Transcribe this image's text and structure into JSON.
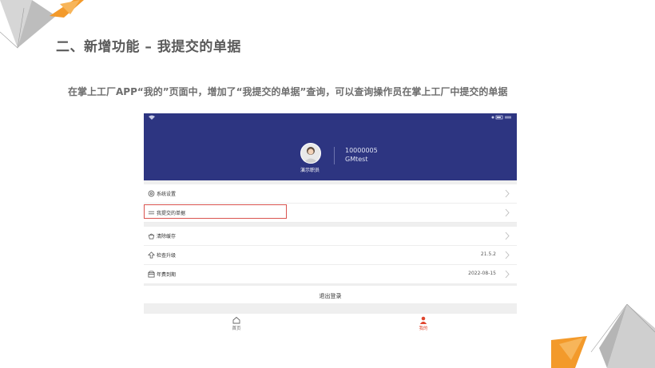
{
  "slide": {
    "title": "二、新增功能 – 我提交的单据",
    "description": "在掌上工厂APP“我的”页面中，增加了“我提交的单据”查询，可以查询操作员在掌上工厂中提交的单据"
  },
  "app": {
    "header": {
      "user_name": "演示职员",
      "user_id": "10000005",
      "account": "GMtest"
    },
    "menu": [
      {
        "icon": "settings-icon",
        "label": "系统设置",
        "value": ""
      },
      {
        "icon": "list-icon",
        "label": "我提交的单据",
        "value": ""
      },
      {
        "icon": "clear-cache-icon",
        "label": "清除缓存",
        "value": ""
      },
      {
        "icon": "upgrade-icon",
        "label": "检查升级",
        "value": "21.5.2"
      },
      {
        "icon": "annual-fee-icon",
        "label": "年费到期",
        "value": "2022-08-15"
      }
    ],
    "logout_label": "退出登录",
    "tabs": [
      {
        "icon": "home-icon",
        "label": "首页"
      },
      {
        "icon": "user-icon",
        "label": "我的"
      }
    ],
    "colors": {
      "header_bg": "#2d3581",
      "accent": "#e0462f",
      "highlight_border": "#d9534f"
    }
  }
}
